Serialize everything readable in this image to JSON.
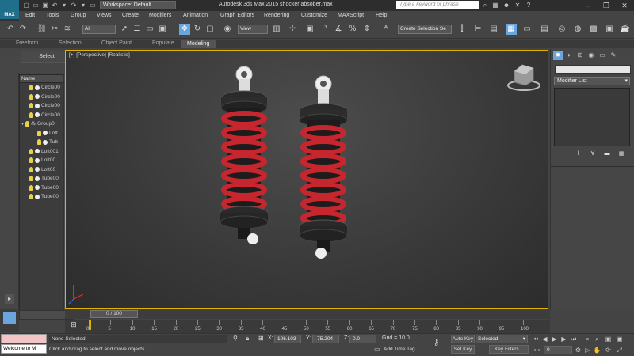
{
  "app": {
    "logo": "MAX",
    "title": "Autodesk 3ds Max  2015     shocker absober.max",
    "workspace": "Workspace: Default",
    "search_placeholder": "Type a keyword or phrase"
  },
  "menu": [
    "Edit",
    "Tools",
    "Group",
    "Views",
    "Create",
    "Modifiers",
    "Animation",
    "Graph Editors",
    "Rendering",
    "Customize",
    "MAXScript",
    "Help"
  ],
  "toolbar": {
    "filter": "All",
    "ref_coord": "View",
    "selection_set": "Create Selection Se"
  },
  "ribbon_tabs": [
    "Freeform",
    "Selection",
    "Object Paint",
    "Populate",
    "Modeling"
  ],
  "ribbon_active": "Modeling",
  "left": {
    "select_label": "Select"
  },
  "scene_explorer": {
    "header": "Name",
    "items": [
      "Circle00",
      "Circle00",
      "Circle00",
      "Circle00",
      "Group0",
      "Loft",
      "Tub",
      "Loft001",
      "Loft00",
      "Loft00",
      "Tube00",
      "Tube00",
      "Tube00"
    ]
  },
  "viewport": {
    "label": "[+] [Perspective] [Realistic]"
  },
  "command_panel": {
    "modifier_list": "Modifier List"
  },
  "time_slider": {
    "position": "0 / 100",
    "ticks": [
      0,
      5,
      10,
      15,
      20,
      25,
      30,
      35,
      40,
      45,
      50,
      55,
      60,
      65,
      70,
      75,
      80,
      85,
      90,
      95,
      100
    ]
  },
  "status": {
    "maxscript_text": "Welcome to M",
    "selection": "None Selected",
    "prompt": "Click and drag to select and move objects",
    "x": "106.103",
    "y": "-75.204",
    "z": "0.0",
    "x_label": "X:",
    "y_label": "Y:",
    "z_label": "Z:",
    "grid": "Grid = 10.0",
    "add_time_tag": "Add Time Tag",
    "auto_key": "Auto Key",
    "set_key": "Set Key",
    "selected": "Selected",
    "key_filters": "Key Filters...",
    "frame": "0"
  },
  "colors": {
    "accent": "#6aa5dc",
    "viewport_border": "#e0b400",
    "spring_red": "#c8262e"
  }
}
